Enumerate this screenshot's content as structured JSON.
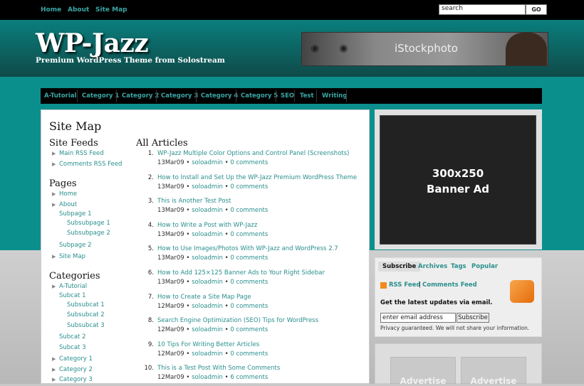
{
  "topnav": {
    "items": [
      "Home",
      "About",
      "Site Map"
    ]
  },
  "search": {
    "value": "search",
    "button": "GO"
  },
  "site": {
    "title": "WP-Jazz",
    "tagline": "Premium WordPress Theme from Solostream"
  },
  "header_banner": {
    "brand": "iStockphoto"
  },
  "catnav": {
    "items": [
      "A-Tutorial",
      "Category 1",
      "Category 2",
      "Category 3",
      "Category 4",
      "Category 5",
      "SEO",
      "Test",
      "Writing"
    ]
  },
  "page": {
    "title": "Site Map"
  },
  "feeds": {
    "heading": "Site Feeds",
    "items": [
      "Main RSS Feed",
      "Comments RSS Feed"
    ]
  },
  "pages": {
    "heading": "Pages",
    "items": [
      "Home",
      "About",
      "Subpage 1",
      "Subsubpage 1",
      "Subsubpage 2",
      "Subpage 2",
      "Site Map"
    ]
  },
  "categories": {
    "heading": "Categories",
    "items": [
      "A-Tutorial",
      "Subcat 1",
      "Subsubcat 1",
      "Subsubcat 2",
      "Subsubcat 3",
      "Subcat 2",
      "Subcat 3",
      "Category 1",
      "Category 2",
      "Category 3"
    ]
  },
  "articles": {
    "heading": "All Articles",
    "items": [
      {
        "num": "1.",
        "title": "WP-Jazz Multiple Color Options and Control Panel (Screenshots)",
        "date": "13Mar09",
        "author": "soloadmin",
        "comments": "0 comments"
      },
      {
        "num": "2.",
        "title": "How to Install and Set Up the WP-Jazz Premium WordPress Theme",
        "date": "13Mar09",
        "author": "soloadmin",
        "comments": "0 comments"
      },
      {
        "num": "3.",
        "title": "This is Another Test Post",
        "date": "13Mar09",
        "author": "soloadmin",
        "comments": "0 comments"
      },
      {
        "num": "4.",
        "title": "How to Write a Post with WP-Jazz",
        "date": "13Mar09",
        "author": "soloadmin",
        "comments": "0 comments"
      },
      {
        "num": "5.",
        "title": "How to Use Images/Photos With WP-Jazz and WordPress 2.7",
        "date": "13Mar09",
        "author": "soloadmin",
        "comments": "0 comments"
      },
      {
        "num": "6.",
        "title": "How to Add 125×125 Banner Ads to Your Right Sidebar",
        "date": "13Mar09",
        "author": "soloadmin",
        "comments": "0 comments"
      },
      {
        "num": "7.",
        "title": "How to Create a Site Map Page",
        "date": "12Mar09",
        "author": "soloadmin",
        "comments": "0 comments"
      },
      {
        "num": "8.",
        "title": "Search Engine Optimization (SEO) Tips for WordPress",
        "date": "12Mar09",
        "author": "soloadmin",
        "comments": "0 comments"
      },
      {
        "num": "9.",
        "title": "10 Tips For Writing Better Articles",
        "date": "12Mar09",
        "author": "soloadmin",
        "comments": "0 comments"
      },
      {
        "num": "10.",
        "title": "This is a Test Post With Some Comments",
        "date": "12Mar09",
        "author": "soloadmin",
        "comments": "6 comments"
      }
    ]
  },
  "sidebar": {
    "banner_line1": "300x250",
    "banner_line2": "Banner Ad",
    "tabs": [
      "Subscribe",
      "Archives",
      "Tags",
      "Popular"
    ],
    "rss_feed": "RSS Feed",
    "rss_sep": "|",
    "comments_feed": "Comments Feed",
    "email_prompt": "Get the latest updates via email.",
    "email_placeholder": "enter email address",
    "subscribe_button": "Subscribe",
    "privacy": "Privacy guaranteed. We will not share your information.",
    "ad_label": "Advertise"
  },
  "colors": {
    "teal": "#0b8f8d",
    "link": "#2a8f8d",
    "nav_link": "#3aa6a4"
  }
}
